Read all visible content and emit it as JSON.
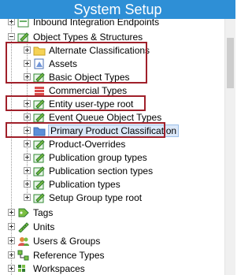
{
  "window": {
    "title": "System Setup"
  },
  "tree": {
    "items": [
      {
        "label": "Inbound Integration Endpoints",
        "icon": "document-folder-icon",
        "expander": "plus"
      },
      {
        "label": "Object Types & Structures",
        "icon": "structure-icon",
        "expander": "minus"
      },
      {
        "label": "Alternate Classifications",
        "icon": "folder-icon",
        "expander": "plus"
      },
      {
        "label": "Assets",
        "icon": "asset-icon",
        "expander": "plus"
      },
      {
        "label": "Basic Object Types",
        "icon": "pencil-type-icon",
        "expander": "plus"
      },
      {
        "label": "Commercial Types",
        "icon": "stack-icon",
        "expander": "none"
      },
      {
        "label": "Entity user-type root",
        "icon": "pencil-type-icon",
        "expander": "plus"
      },
      {
        "label": "Event Queue Object Types",
        "icon": "pencil-type-icon",
        "expander": "plus"
      },
      {
        "label": "Primary Product Classification",
        "icon": "blue-folder-icon",
        "expander": "plus",
        "selected": true
      },
      {
        "label": "Product-Overrides",
        "icon": "pencil-type-icon",
        "expander": "plus"
      },
      {
        "label": "Publication group types",
        "icon": "pencil-type-icon",
        "expander": "plus"
      },
      {
        "label": "Publication section types",
        "icon": "pencil-type-icon",
        "expander": "plus"
      },
      {
        "label": "Publication types",
        "icon": "pencil-type-icon",
        "expander": "plus"
      },
      {
        "label": "Setup Group type root",
        "icon": "pencil-type-icon",
        "expander": "plus"
      },
      {
        "label": "Tags",
        "icon": "tag-icon",
        "expander": "plus"
      },
      {
        "label": "Units",
        "icon": "ruler-icon",
        "expander": "plus"
      },
      {
        "label": "Users & Groups",
        "icon": "users-icon",
        "expander": "plus"
      },
      {
        "label": "Reference Types",
        "icon": "reference-icon",
        "expander": "plus"
      },
      {
        "label": "Workspaces",
        "icon": "workspace-icon",
        "expander": "plus"
      }
    ]
  },
  "colors": {
    "titlebar": "#2e8fd6",
    "highlight": "#a0202a",
    "folder": "#f5d255",
    "blueFolder": "#5b8fd9"
  }
}
